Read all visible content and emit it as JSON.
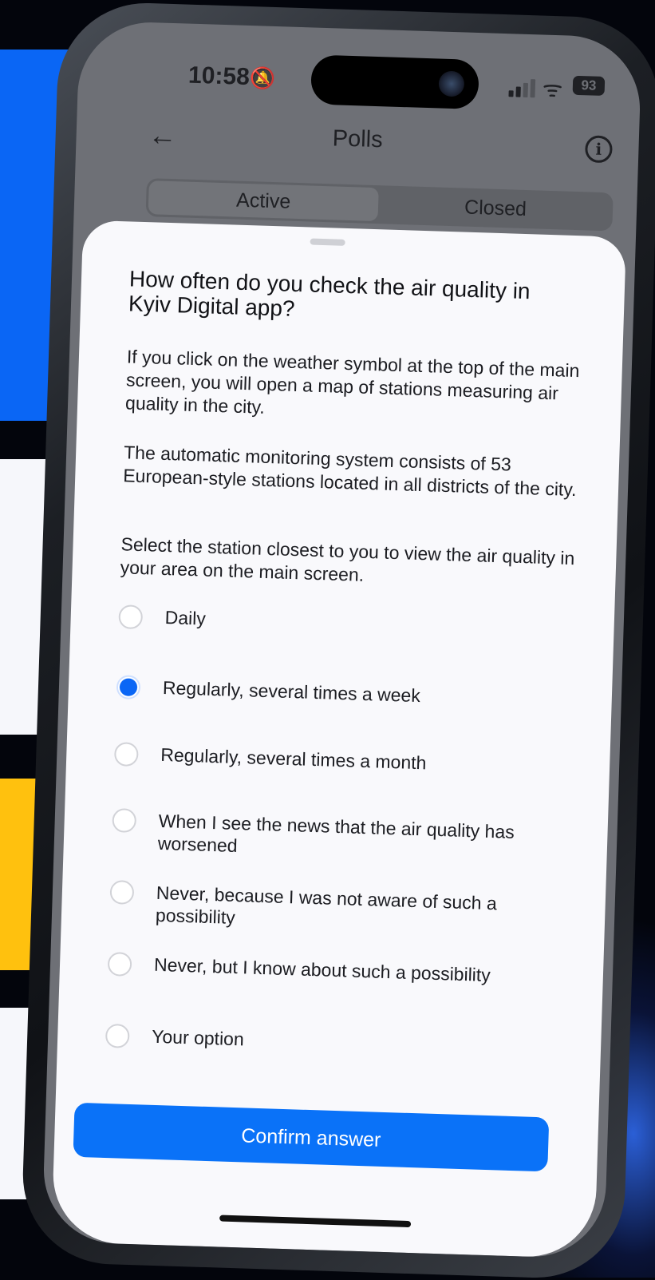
{
  "status_bar": {
    "time": "10:58",
    "battery": "93",
    "icons": [
      "bell-slash-icon",
      "signal-icon",
      "wifi-icon",
      "battery-icon"
    ]
  },
  "header": {
    "title": "Polls",
    "back_icon": "back-arrow-icon",
    "info_icon": "info-icon"
  },
  "tabs": [
    {
      "label": "Active",
      "selected": true
    },
    {
      "label": "Closed",
      "selected": false
    }
  ],
  "poll": {
    "question": "How often do you check the air quality in Kyiv Digital app?",
    "description": [
      "If you click on the weather symbol at the top of the main screen, you will open a map of stations measuring air quality in the city.",
      "The automatic monitoring system consists of 53 European-style stations located in all districts of the city.",
      "Select the station closest to you to view the air quality in your area on the main screen."
    ],
    "options": [
      {
        "label": "Daily",
        "selected": false
      },
      {
        "label": "Regularly, several times a week",
        "selected": true
      },
      {
        "label": "Regularly, several times a month",
        "selected": false
      },
      {
        "label": "When I see the news that the air quality has worsened",
        "selected": false
      },
      {
        "label": "Never, because I was not aware of such a possibility",
        "selected": false
      },
      {
        "label": "Never, but I know about such a possibility",
        "selected": false
      },
      {
        "label": "Your option",
        "selected": false
      }
    ],
    "confirm_label": "Confirm answer"
  },
  "colors": {
    "accent": "#0a72f8",
    "bg_blue": "#0a66f5",
    "bg_yellow": "#ffc10e"
  }
}
